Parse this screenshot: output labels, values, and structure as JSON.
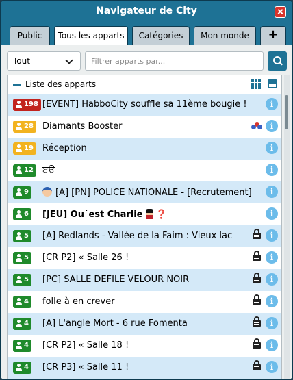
{
  "window": {
    "title": "Navigateur de City"
  },
  "tabs": [
    {
      "label": "Public",
      "active": false
    },
    {
      "label": "Tous les apparts",
      "active": true
    },
    {
      "label": "Catégories",
      "active": false
    },
    {
      "label": "Mon monde",
      "active": false
    },
    {
      "label": "+",
      "active": false
    }
  ],
  "filter": {
    "type_value": "Tout",
    "placeholder": "Filtrer apparts par..."
  },
  "list": {
    "title": "Liste des apparts",
    "rows": [
      {
        "count": "198",
        "badge_color": "#c2231e",
        "name": "[EVENT] HabboCity souffle sa 11ème bougie !",
        "bold": false,
        "lock": false,
        "people": false
      },
      {
        "count": "28",
        "badge_color": "#f2b320",
        "name": "Diamants Booster",
        "bold": false,
        "lock": false,
        "people": true
      },
      {
        "count": "19",
        "badge_color": "#f2b320",
        "name": "Réception",
        "bold": false,
        "lock": false,
        "people": false
      },
      {
        "count": "12",
        "badge_color": "#1f8a2b",
        "name": "ੲੳ",
        "bold": false,
        "lock": false,
        "people": false
      },
      {
        "count": "9",
        "badge_color": "#1f8a2b",
        "name": "[A] [PN] POLICE NATIONALE - [Recrutement]",
        "bold": false,
        "lock": false,
        "people": false,
        "prefix_icon": "police-officer-emoji"
      },
      {
        "count": "6",
        "badge_color": "#1f8a2b",
        "name": "[JEU] Ou˙est Charlie",
        "bold": true,
        "lock": false,
        "people": false,
        "suffix_icon": "guard-emoji",
        "suffix_text": "❓"
      },
      {
        "count": "5",
        "badge_color": "#1f8a2b",
        "name": "[A] Redlands - Vallée de la Faim : Vieux lac",
        "bold": false,
        "lock": true,
        "people": false
      },
      {
        "count": "5",
        "badge_color": "#1f8a2b",
        "name": "[CR P2] « Salle 26 !",
        "bold": false,
        "lock": true,
        "people": false
      },
      {
        "count": "5",
        "badge_color": "#1f8a2b",
        "name": "[PC] SALLE DEFILE VELOUR NOIR",
        "bold": false,
        "lock": true,
        "people": false
      },
      {
        "count": "4",
        "badge_color": "#1f8a2b",
        "name": "folle à en crever",
        "bold": false,
        "lock": true,
        "people": false
      },
      {
        "count": "4",
        "badge_color": "#1f8a2b",
        "name": "[A] L'angle Mort - 6 rue Fomenta",
        "bold": false,
        "lock": true,
        "people": false
      },
      {
        "count": "4",
        "badge_color": "#1f8a2b",
        "name": "[CR P2] « Salle 18 !",
        "bold": false,
        "lock": true,
        "people": false
      },
      {
        "count": "4",
        "badge_color": "#1f8a2b",
        "name": "[CR P3] « Salle 11 !",
        "bold": false,
        "lock": true,
        "people": false
      }
    ]
  },
  "colors": {
    "accent": "#1e7295",
    "row_alt": "#d4e9f8",
    "info": "#6cbcea"
  }
}
